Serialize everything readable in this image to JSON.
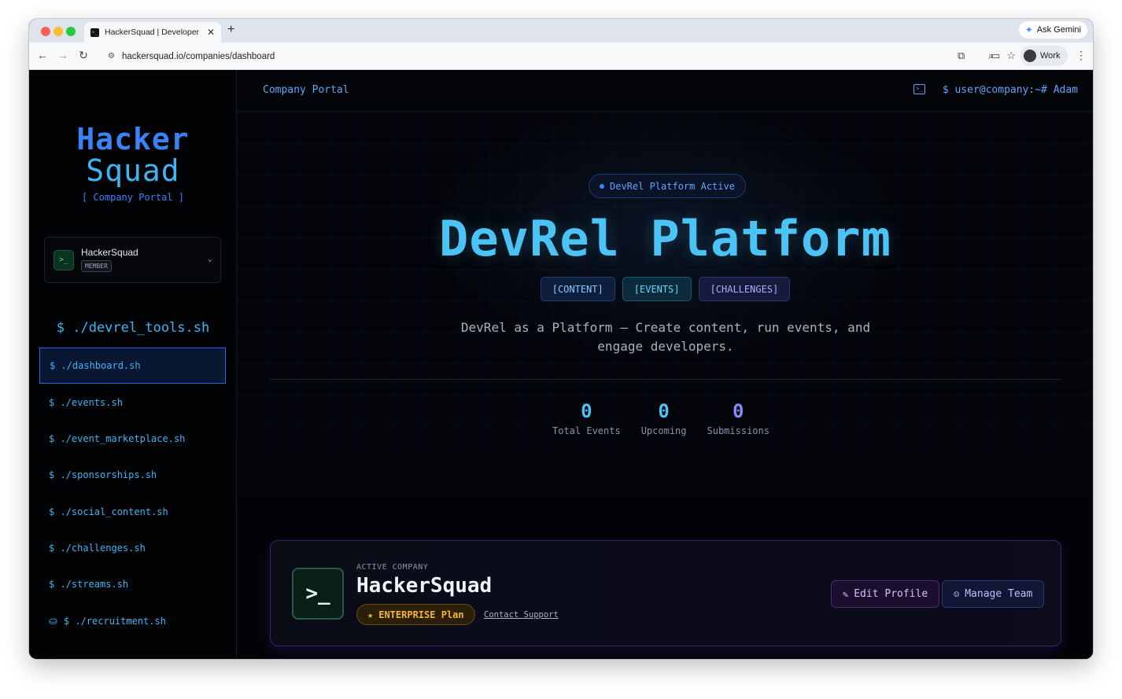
{
  "browser": {
    "tab_title": "HackerSquad | Developer Eco",
    "tab_favicon": ">_",
    "tab_close": "✕",
    "new_tab": "+",
    "ask_gemini": "Ask Gemini",
    "url": "hackersquad.io/companies/dashboard",
    "profile_label": "Work",
    "nav": {
      "back": "←",
      "forward": "→",
      "reload": "↻"
    },
    "icons": {
      "zoom": "⌕",
      "star": "☆",
      "extensions": "⧉",
      "cast": "▭",
      "menu": "⋮"
    }
  },
  "sidebar": {
    "logo_line1": "Hacker",
    "logo_line2": "Squad",
    "logo_subtitle": "[ Company Portal ]",
    "org": {
      "icon": ">_",
      "name": "HackerSquad",
      "role": "MEMBER",
      "chevron": "⌄"
    },
    "nav_title": "$ ./devrel_tools.sh",
    "items": [
      {
        "label": "$ ./dashboard.sh",
        "active": true
      },
      {
        "label": "$ ./events.sh"
      },
      {
        "label": "$ ./event_marketplace.sh"
      },
      {
        "label": "$ ./sponsorships.sh"
      },
      {
        "label": "$ ./social_content.sh"
      },
      {
        "label": "$ ./challenges.sh"
      },
      {
        "label": "$ ./streams.sh"
      },
      {
        "label": "$ ./recruitment.sh",
        "icon": "briefcase-icon"
      }
    ]
  },
  "topbar": {
    "portal_label": "Company Portal",
    "user_prompt": "$ user@company:~# Adam"
  },
  "hero": {
    "status": "DevRel Platform Active",
    "title": "DevRel Platform",
    "tags": [
      "[CONTENT]",
      "[EVENTS]",
      "[CHALLENGES]"
    ],
    "description": "DevRel as a Platform — Create content, run events, and engage developers.",
    "stats": [
      {
        "value": "0",
        "label": "Total Events"
      },
      {
        "value": "0",
        "label": "Upcoming"
      },
      {
        "value": "0",
        "label": "Submissions"
      }
    ]
  },
  "company": {
    "eyebrow": "ACTIVE COMPANY",
    "name": "HackerSquad",
    "icon": ">_",
    "plan": "ENTERPRISE Plan",
    "plan_icon": "★",
    "support_link": "Contact Support",
    "edit_button": "Edit Profile",
    "team_button": "Manage Team"
  },
  "colors": {
    "accent_blue": "#3b82f6",
    "accent_cyan": "#4cc3f5",
    "plan_gold": "#f5b431",
    "active_border": "#2c5ef0"
  }
}
